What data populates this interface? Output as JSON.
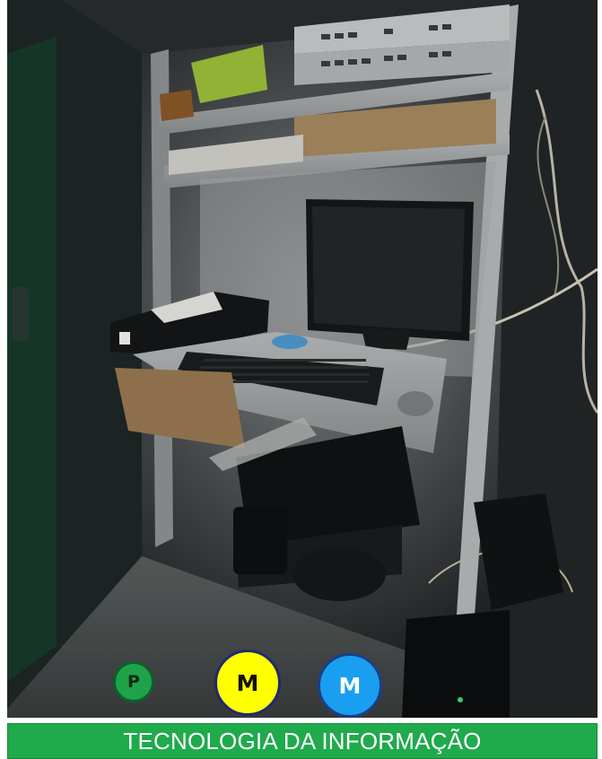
{
  "badges": [
    {
      "letter": "P",
      "color": "#1fa34a"
    },
    {
      "letter": "M",
      "color": "#ffff00"
    },
    {
      "letter": "M",
      "color": "#1a9ff0"
    }
  ],
  "footer": {
    "title": "TECNOLOGIA DA INFORMAÇÃO",
    "color": "#1faa4b"
  }
}
